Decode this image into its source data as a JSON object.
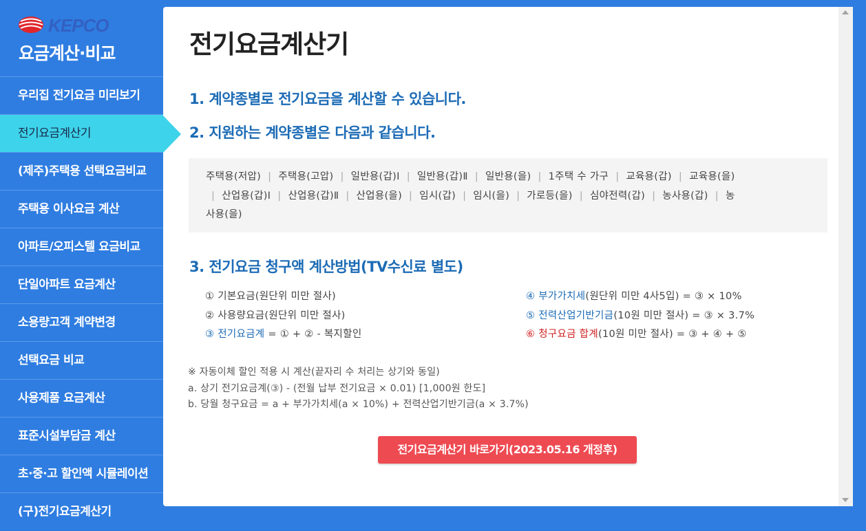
{
  "brand": {
    "logo_text": "KEPCO",
    "app_title": "요금계산·비교"
  },
  "sidebar": {
    "items": [
      {
        "label": "우리집 전기요금 미리보기",
        "active": false
      },
      {
        "label": "전기요금계산기",
        "active": true
      },
      {
        "label": "(제주)주택용 선택요금비교",
        "active": false
      },
      {
        "label": "주택용 이사요금 계산",
        "active": false
      },
      {
        "label": "아파트/오피스텔 요금비교",
        "active": false
      },
      {
        "label": "단일아파트 요금계산",
        "active": false
      },
      {
        "label": "소용량고객 계약변경",
        "active": false
      },
      {
        "label": "선택요금 비교",
        "active": false
      },
      {
        "label": "사용제품 요금계산",
        "active": false
      },
      {
        "label": "표준시설부담금 계산",
        "active": false
      },
      {
        "label": "초·중·고 할인액 시뮬레이션",
        "active": false
      },
      {
        "label": "(구)전기요금계산기",
        "active": false
      }
    ]
  },
  "main": {
    "title": "전기요금계산기",
    "step1": "1. 계약종별로 전기요금을 계산할 수 있습니다.",
    "step2": "2. 지원하는 계약종별은 다음과 같습니다.",
    "contracts_line1": [
      "주택용(저압)",
      "주택용(고압)",
      "일반용(갑)Ⅰ",
      "일반용(갑)Ⅱ",
      "일반용(을)",
      "1주택 수 가구",
      "교육용(갑)",
      "교육용(을)"
    ],
    "contracts_line2": [
      "산업용(갑)Ⅰ",
      "산업용(갑)Ⅱ",
      "산업용(을)",
      "임시(갑)",
      "임시(을)",
      "가로등(을)",
      "심야전력(갑)",
      "농사용(갑)"
    ],
    "contracts_line2_tail": "농",
    "contracts_line3": "사용(을)",
    "step3": "3. 전기요금 청구액 계산방법(TV수신료 별도)",
    "calc_left": {
      "l1": "① 기본요금(원단위 미만 절사)",
      "l2": "② 사용량요금(원단위 미만 절사)",
      "l3_hl": "③ 전기요금계",
      "l3_rest": " = ① + ② - 복지할인"
    },
    "calc_right": {
      "l1_hl": "④ 부가가치세",
      "l1_rest": "(원단위 미만 4사5입) = ③ × 10%",
      "l2_hl": "⑤ 전력산업기반기금",
      "l2_rest": "(10원 미만 절사) = ③ × 3.7%",
      "l3_hl": "⑥ 청구요금 합계",
      "l3_rest": "(10원 미만 절사) = ③ + ④ + ⑤"
    },
    "notes": {
      "n1": "※ 자동이체 할인 적용 시 계산(끝자리 수 처리는 상기와 동일)",
      "n2": "a. 상기 전기요금계(③) - (전월 납부 전기요금 × 0.01) [1,000원 한도]",
      "n3": "b. 당월 청구요금 = a + 부가가치세(a × 10%) + 전력산업기반기금(a × 3.7%)"
    },
    "cta_label": "전기요금계산기 바로가기(2023.05.16 개정후)"
  },
  "colors": {
    "background": "#2f7de1",
    "active_menu": "#3dd3ea",
    "heading_blue": "#1c6bb5",
    "highlight_red": "#d01f1f",
    "cta": "#ee4a52"
  }
}
